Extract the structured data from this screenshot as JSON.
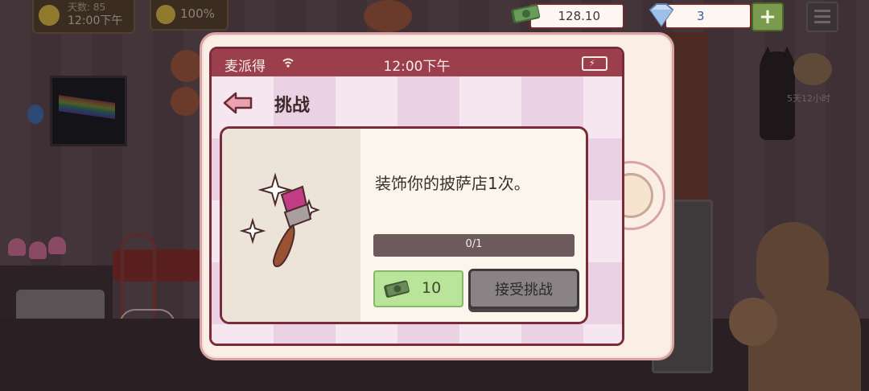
{
  "hud": {
    "days_label": "天数: 85",
    "clock": "12:00下午",
    "mood_percent": "100%",
    "money": "128.10",
    "gems": "3",
    "plus_label": "+"
  },
  "background": {
    "cat_timer": "5天12小时"
  },
  "phone": {
    "carrier": "麦派得",
    "time": "12:00下午",
    "page_title": "挑战",
    "challenge": {
      "description": "装饰你的披萨店1次。",
      "progress_text": "0/1",
      "progress_fraction": 0,
      "reward": "10",
      "accept_label": "接受挑战"
    }
  },
  "colors": {
    "status_bar": "#9a3f4b",
    "frame": "#7a2b3a",
    "reward_bg": "#b9e49a",
    "accept_bg": "#8a8385"
  },
  "icons": [
    "sun-icon",
    "smile-icon",
    "money-icon",
    "gem-icon",
    "menu-icon",
    "wifi-icon",
    "battery-icon",
    "back-arrow-icon",
    "paintbrush-icon",
    "cash-icon"
  ]
}
